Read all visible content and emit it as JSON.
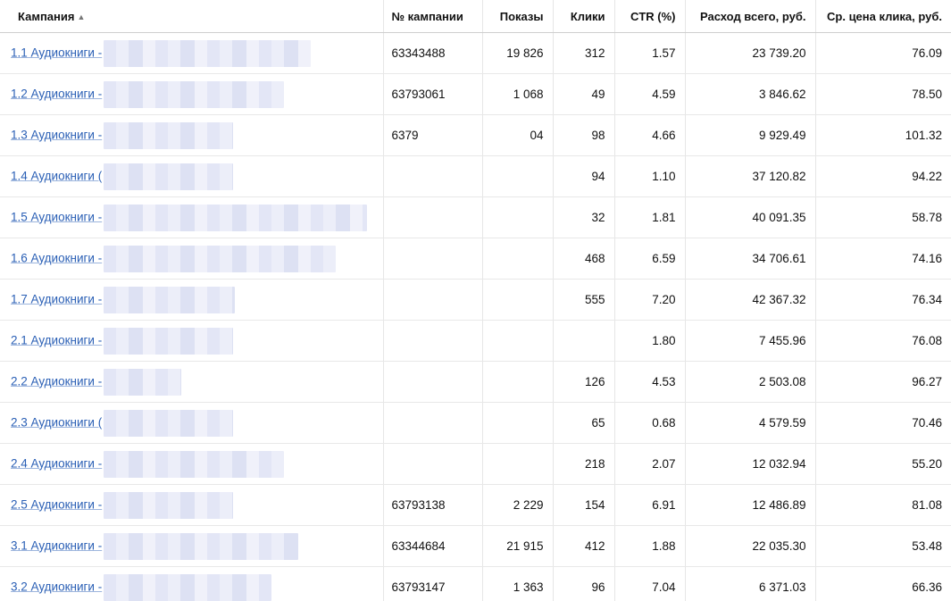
{
  "columns": {
    "name": "Кампания",
    "id": "№ кампании",
    "shows": "Показы",
    "clicks": "Клики",
    "ctr": "CTR (%)",
    "spend": "Расход всего, руб.",
    "cpc": "Ср. цена клика, руб."
  },
  "sort_indicator": "▲",
  "rows": [
    {
      "name": "1.1 Аудиокниги -",
      "id": "63343488",
      "shows": "19 826",
      "clicks": "312",
      "ctr": "1.57",
      "spend": "23 739.20",
      "cpc": "76.09"
    },
    {
      "name": "1.2 Аудиокниги -",
      "id": "63793061",
      "shows": "1 068",
      "clicks": "49",
      "ctr": "4.59",
      "spend": "3 846.62",
      "cpc": "78.50"
    },
    {
      "name": "1.3 Аудиокниги -",
      "id": "6379",
      "shows": "04",
      "clicks": "98",
      "ctr": "4.66",
      "spend": "9 929.49",
      "cpc": "101.32"
    },
    {
      "name": "1.4 Аудиокниги (",
      "id": "",
      "shows": "",
      "clicks": "94",
      "ctr": "1.10",
      "spend": "37 120.82",
      "cpc": "94.22"
    },
    {
      "name": "1.5 Аудиокниги -",
      "id": "",
      "shows": "",
      "clicks": "32",
      "ctr": "1.81",
      "spend": "40 091.35",
      "cpc": "58.78"
    },
    {
      "name": "1.6 Аудиокниги -",
      "id": "",
      "shows": "",
      "clicks": "468",
      "ctr": "6.59",
      "spend": "34 706.61",
      "cpc": "74.16"
    },
    {
      "name": "1.7 Аудиокниги -",
      "id": "",
      "shows": "",
      "clicks": "555",
      "ctr": "7.20",
      "spend": "42 367.32",
      "cpc": "76.34"
    },
    {
      "name": "2.1 Аудиокниги -",
      "id": "",
      "shows": "",
      "clicks": "",
      "ctr": "1.80",
      "spend": "7 455.96",
      "cpc": "76.08"
    },
    {
      "name": "2.2 Аудиокниги -",
      "id": "",
      "shows": "",
      "clicks": "126",
      "ctr": "4.53",
      "spend": "2 503.08",
      "cpc": "96.27"
    },
    {
      "name": "2.3 Аудиокниги (",
      "id": "",
      "shows": "",
      "clicks": "65",
      "ctr": "0.68",
      "spend": "4 579.59",
      "cpc": "70.46"
    },
    {
      "name": "2.4 Аудиокниги -",
      "id": "",
      "shows": "",
      "clicks": "218",
      "ctr": "2.07",
      "spend": "12 032.94",
      "cpc": "55.20"
    },
    {
      "name": "2.5 Аудиокниги -",
      "id": "63793138",
      "shows": "2 229",
      "clicks": "154",
      "ctr": "6.91",
      "spend": "12 486.89",
      "cpc": "81.08"
    },
    {
      "name": "3.1 Аудиокниги -",
      "id": "63344684",
      "shows": "21 915",
      "clicks": "412",
      "ctr": "1.88",
      "spend": "22 035.30",
      "cpc": "53.48"
    },
    {
      "name": "3.2 Аудиокниги -",
      "id": "63793147",
      "shows": "1 363",
      "clicks": "96",
      "ctr": "7.04",
      "spend": "6 371.03",
      "cpc": "66.36"
    }
  ]
}
